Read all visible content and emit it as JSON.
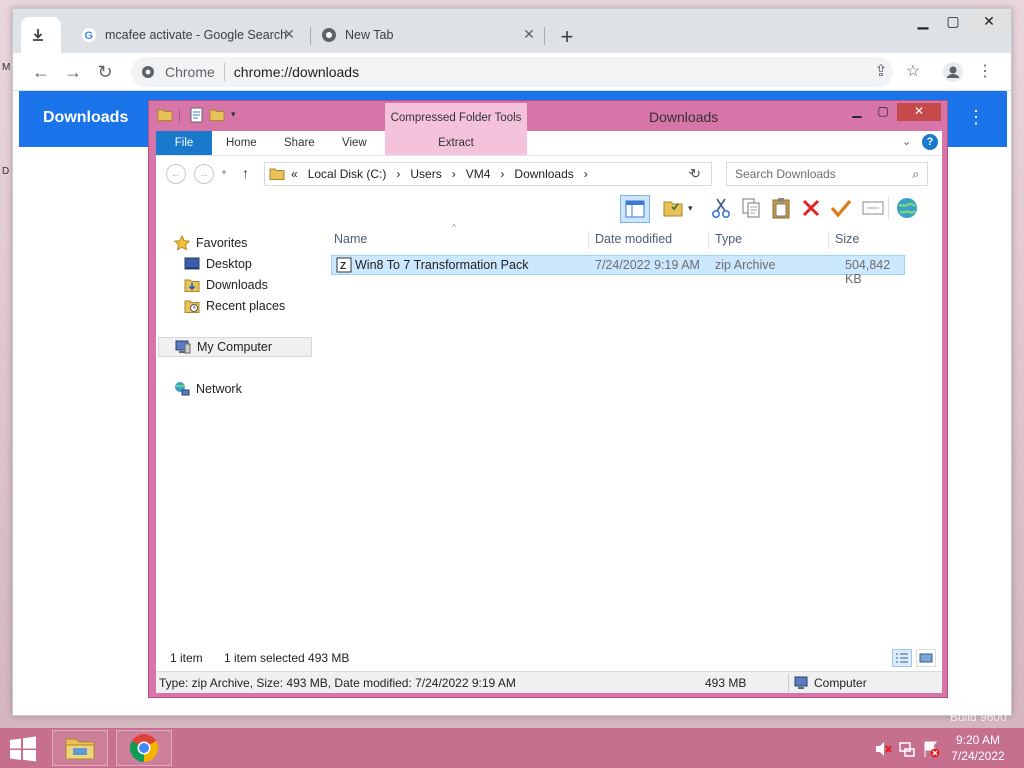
{
  "chrome": {
    "tabs": [
      {
        "label": "",
        "icon": "download-icon"
      },
      {
        "label": "mcafee activate - Google Search",
        "icon": "google-icon"
      },
      {
        "label": "New Tab",
        "icon": "chrome-icon"
      }
    ],
    "omnibox": {
      "scheme": "Chrome",
      "url": "chrome://downloads"
    },
    "downloads_title": "Downloads"
  },
  "explorer": {
    "title": "Downloads",
    "context_tab": "Compressed Folder Tools",
    "ribbon_tabs": {
      "file": "File",
      "home": "Home",
      "share": "Share",
      "view": "View",
      "extract": "Extract"
    },
    "breadcrumb": {
      "prefix": "«",
      "parts": [
        "Local Disk (C:)",
        "Users",
        "VM4",
        "Downloads"
      ]
    },
    "search_placeholder": "Search Downloads",
    "nav": {
      "favorites": "Favorites",
      "desktop": "Desktop",
      "downloads": "Downloads",
      "recent": "Recent places",
      "computer": "My Computer",
      "network": "Network"
    },
    "columns": {
      "name": "Name",
      "date": "Date modified",
      "type": "Type",
      "size": "Size"
    },
    "files": [
      {
        "name": "Win8 To 7 Transformation Pack",
        "date": "7/24/2022 9:19 AM",
        "type": "zip Archive",
        "size": "504,842 KB"
      }
    ],
    "status": {
      "count": "1 item",
      "selected": "1 item selected  493 MB"
    },
    "details": {
      "text": "Type: zip Archive, Size: 493 MB, Date modified: 7/24/2022 9:19 AM",
      "size": "493 MB",
      "location": "Computer"
    }
  },
  "taskbar": {
    "time": "9:20 AM",
    "date": "7/24/2022"
  },
  "watermark": "Build 9600",
  "colors": {
    "accent": "#1a73e8",
    "explorer_frame": "#d775a8",
    "taskbar": "#c66f8f",
    "selection": "#cce8ff"
  }
}
